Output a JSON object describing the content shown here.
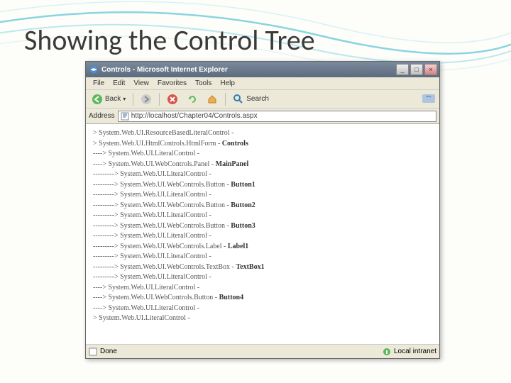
{
  "slide": {
    "title": "Showing the Control Tree"
  },
  "window": {
    "title": "Controls - Microsoft Internet Explorer",
    "buttons": {
      "minimize": "_",
      "maximize": "□",
      "close": "×"
    }
  },
  "menu": {
    "file": "File",
    "edit": "Edit",
    "view": "View",
    "favorites": "Favorites",
    "tools": "Tools",
    "help": "Help"
  },
  "toolbar": {
    "back": "Back",
    "search": "Search"
  },
  "address": {
    "label": "Address",
    "url": "http://localhost/Chapter04/Controls.aspx"
  },
  "tree": [
    {
      "prefix": "> ",
      "type": "System.Web.UI.ResourceBasedLiteralControl",
      "name": ""
    },
    {
      "prefix": "> ",
      "type": "System.Web.UI.HtmlControls.HtmlForm",
      "name": "Controls"
    },
    {
      "prefix": "----> ",
      "type": "System.Web.UI.LiteralControl",
      "name": ""
    },
    {
      "prefix": "----> ",
      "type": "System.Web.UI.WebControls.Panel",
      "name": "MainPanel"
    },
    {
      "prefix": "---------> ",
      "type": "System.Web.UI.LiteralControl",
      "name": ""
    },
    {
      "prefix": "---------> ",
      "type": "System.Web.UI.WebControls.Button",
      "name": "Button1"
    },
    {
      "prefix": "---------> ",
      "type": "System.Web.UI.LiteralControl",
      "name": ""
    },
    {
      "prefix": "---------> ",
      "type": "System.Web.UI.WebControls.Button",
      "name": "Button2"
    },
    {
      "prefix": "---------> ",
      "type": "System.Web.UI.LiteralControl",
      "name": ""
    },
    {
      "prefix": "---------> ",
      "type": "System.Web.UI.WebControls.Button",
      "name": "Button3"
    },
    {
      "prefix": "---------> ",
      "type": "System.Web.UI.LiteralControl",
      "name": ""
    },
    {
      "prefix": "---------> ",
      "type": "System.Web.UI.WebControls.Label",
      "name": "Label1"
    },
    {
      "prefix": "---------> ",
      "type": "System.Web.UI.LiteralControl",
      "name": ""
    },
    {
      "prefix": "---------> ",
      "type": "System.Web.UI.WebControls.TextBox",
      "name": "TextBox1"
    },
    {
      "prefix": "---------> ",
      "type": "System.Web.UI.LiteralControl",
      "name": ""
    },
    {
      "prefix": "----> ",
      "type": "System.Web.UI.LiteralControl",
      "name": ""
    },
    {
      "prefix": "----> ",
      "type": "System.Web.UI.WebControls.Button",
      "name": "Button4"
    },
    {
      "prefix": "----> ",
      "type": "System.Web.UI.LiteralControl",
      "name": ""
    },
    {
      "prefix": "> ",
      "type": "System.Web.UI.LiteralControl",
      "name": ""
    }
  ],
  "status": {
    "done": "Done",
    "zone": "Local intranet"
  }
}
